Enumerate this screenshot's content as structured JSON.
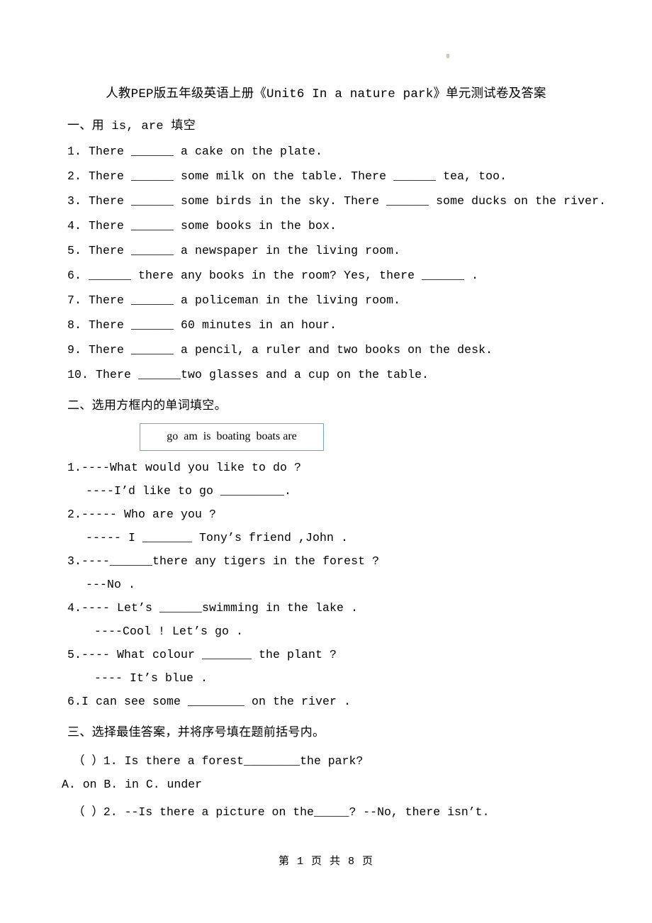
{
  "document": {
    "title": "人教PEP版五年级英语上册《Unit6 In a nature park》单元测试卷及答案",
    "footer": "第 1 页 共 8 页"
  },
  "colors": {
    "wordbank_border": "#7aa3cc",
    "text": "#000000",
    "page_background": "#ffffff"
  },
  "sections": {
    "one": {
      "heading": "一、用 is, are 填空",
      "items": [
        "1. There ______ a cake on the plate.",
        "2. There ______ some milk on the table. There ______ tea, too.",
        "3. There ______ some birds in the sky. There ______ some ducks on the river.",
        "4. There ______ some books in the box.",
        "5. There ______ a newspaper in the living room.",
        "6. ______ there any books in the room? Yes, there ______ .",
        "7. There ______ a policeman in the living room.",
        "8. There ______ 60 minutes in an hour.",
        "9. There ______ a pencil, a ruler and two books on the desk.",
        "10. There ______two glasses and a cup on the table."
      ]
    },
    "two": {
      "heading": "二、选用方框内的单词填空。",
      "wordbank": "go  am  is  boating  boats are",
      "items": [
        {
          "main": "1.----What would you like to do ?",
          "reply": "----I’d like to go _________.",
          "indent": "normal"
        },
        {
          "main": "2.----- Who are you ?",
          "reply": "----- I _______ Tony’s friend ,John .",
          "indent": "normal"
        },
        {
          "main": "3.----______there any tigers in the forest ?",
          "reply": "---No .",
          "indent": "normal"
        },
        {
          "main": "4.---- Let’s  ______swimming in the lake .",
          "reply": "----Cool ! Let’s go .",
          "indent": "deep"
        },
        {
          "main": "5.---- What colour _______ the plant ?",
          "reply": "---- It’s blue .",
          "indent": "deep"
        },
        {
          "main": "6.I can see some ________ on the river .",
          "reply": "",
          "indent": "normal"
        }
      ]
    },
    "three": {
      "heading": "三、选择最佳答案，并将序号填在题前括号内。",
      "questions": [
        {
          "stem": "（  ）1. Is there a forest________the park?",
          "options": "A. on     B. in    C. under"
        },
        {
          "stem": "（  ）2. --Is there a picture on the_____?     --No, there isn’t.",
          "options": ""
        }
      ]
    }
  }
}
